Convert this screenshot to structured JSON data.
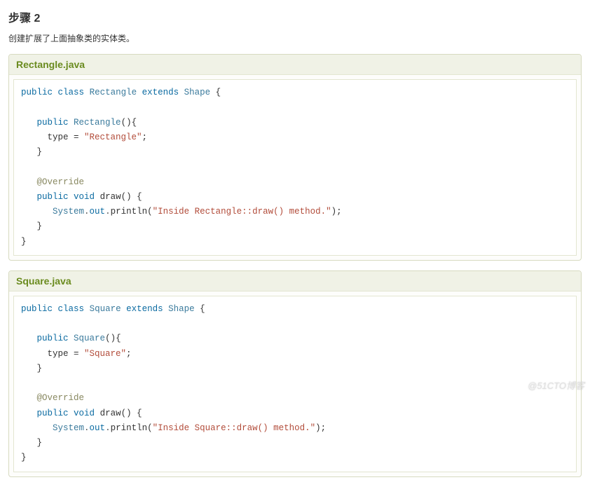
{
  "step": {
    "title": "步骤 2",
    "description": "创建扩展了上面抽象类的实体类。"
  },
  "examples": [
    {
      "filename": "Rectangle.java",
      "code_plain": "public class Rectangle extends Shape {\n\n   public Rectangle(){\n     type = \"Rectangle\";\n   }\n\n   @Override\n   public void draw() {\n      System.out.println(\"Inside Rectangle::draw() method.\");\n   }\n}",
      "tokens": [
        {
          "t": "kw",
          "v": "public"
        },
        {
          "t": "pln",
          "v": " "
        },
        {
          "t": "kw",
          "v": "class"
        },
        {
          "t": "pln",
          "v": " "
        },
        {
          "t": "type",
          "v": "Rectangle"
        },
        {
          "t": "pln",
          "v": " "
        },
        {
          "t": "kw",
          "v": "extends"
        },
        {
          "t": "pln",
          "v": " "
        },
        {
          "t": "type",
          "v": "Shape"
        },
        {
          "t": "pln",
          "v": " {"
        },
        {
          "t": "nl"
        },
        {
          "t": "nl"
        },
        {
          "t": "pln",
          "v": "   "
        },
        {
          "t": "kw",
          "v": "public"
        },
        {
          "t": "pln",
          "v": " "
        },
        {
          "t": "type",
          "v": "Rectangle"
        },
        {
          "t": "pln",
          "v": "(){"
        },
        {
          "t": "nl"
        },
        {
          "t": "pln",
          "v": "     type = "
        },
        {
          "t": "str",
          "v": "\"Rectangle\""
        },
        {
          "t": "pln",
          "v": ";"
        },
        {
          "t": "nl"
        },
        {
          "t": "pln",
          "v": "   }"
        },
        {
          "t": "nl"
        },
        {
          "t": "nl"
        },
        {
          "t": "pln",
          "v": "   "
        },
        {
          "t": "ann",
          "v": "@Override"
        },
        {
          "t": "nl"
        },
        {
          "t": "pln",
          "v": "   "
        },
        {
          "t": "kw",
          "v": "public"
        },
        {
          "t": "pln",
          "v": " "
        },
        {
          "t": "kw",
          "v": "void"
        },
        {
          "t": "pln",
          "v": " draw() {"
        },
        {
          "t": "nl"
        },
        {
          "t": "pln",
          "v": "      "
        },
        {
          "t": "type",
          "v": "System"
        },
        {
          "t": "dot",
          "v": "."
        },
        {
          "t": "kw",
          "v": "out"
        },
        {
          "t": "dot",
          "v": "."
        },
        {
          "t": "pln",
          "v": "println("
        },
        {
          "t": "str",
          "v": "\"Inside Rectangle::draw() method.\""
        },
        {
          "t": "pln",
          "v": ");"
        },
        {
          "t": "nl"
        },
        {
          "t": "pln",
          "v": "   }"
        },
        {
          "t": "nl"
        },
        {
          "t": "pln",
          "v": "}"
        }
      ]
    },
    {
      "filename": "Square.java",
      "code_plain": "public class Square extends Shape {\n\n   public Square(){\n     type = \"Square\";\n   }\n\n   @Override\n   public void draw() {\n      System.out.println(\"Inside Square::draw() method.\");\n   }\n}",
      "tokens": [
        {
          "t": "kw",
          "v": "public"
        },
        {
          "t": "pln",
          "v": " "
        },
        {
          "t": "kw",
          "v": "class"
        },
        {
          "t": "pln",
          "v": " "
        },
        {
          "t": "type",
          "v": "Square"
        },
        {
          "t": "pln",
          "v": " "
        },
        {
          "t": "kw",
          "v": "extends"
        },
        {
          "t": "pln",
          "v": " "
        },
        {
          "t": "type",
          "v": "Shape"
        },
        {
          "t": "pln",
          "v": " {"
        },
        {
          "t": "nl"
        },
        {
          "t": "nl"
        },
        {
          "t": "pln",
          "v": "   "
        },
        {
          "t": "kw",
          "v": "public"
        },
        {
          "t": "pln",
          "v": " "
        },
        {
          "t": "type",
          "v": "Square"
        },
        {
          "t": "pln",
          "v": "(){"
        },
        {
          "t": "nl"
        },
        {
          "t": "pln",
          "v": "     type = "
        },
        {
          "t": "str",
          "v": "\"Square\""
        },
        {
          "t": "pln",
          "v": ";"
        },
        {
          "t": "nl"
        },
        {
          "t": "pln",
          "v": "   }"
        },
        {
          "t": "nl"
        },
        {
          "t": "nl"
        },
        {
          "t": "pln",
          "v": "   "
        },
        {
          "t": "ann",
          "v": "@Override"
        },
        {
          "t": "nl"
        },
        {
          "t": "pln",
          "v": "   "
        },
        {
          "t": "kw",
          "v": "public"
        },
        {
          "t": "pln",
          "v": " "
        },
        {
          "t": "kw",
          "v": "void"
        },
        {
          "t": "pln",
          "v": " draw() {"
        },
        {
          "t": "nl"
        },
        {
          "t": "pln",
          "v": "      "
        },
        {
          "t": "type",
          "v": "System"
        },
        {
          "t": "dot",
          "v": "."
        },
        {
          "t": "kw",
          "v": "out"
        },
        {
          "t": "dot",
          "v": "."
        },
        {
          "t": "pln",
          "v": "println("
        },
        {
          "t": "str",
          "v": "\"Inside Square::draw() method.\""
        },
        {
          "t": "pln",
          "v": ");"
        },
        {
          "t": "nl"
        },
        {
          "t": "pln",
          "v": "   }"
        },
        {
          "t": "nl"
        },
        {
          "t": "pln",
          "v": "}"
        }
      ]
    }
  ],
  "watermark": "@51CTO博客"
}
